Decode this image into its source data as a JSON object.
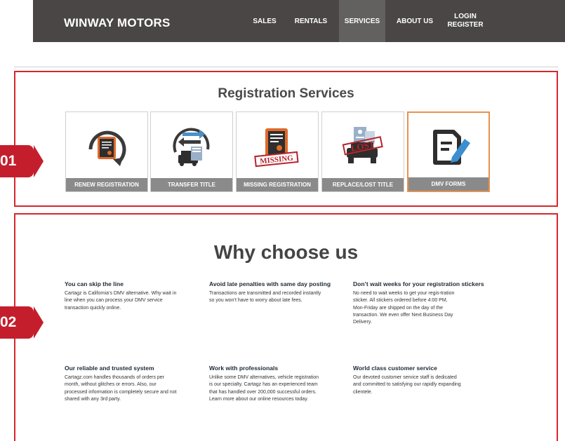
{
  "nav": {
    "brand": "WINWAY MOTORS",
    "items": [
      "SALES",
      "RENTALS",
      "SERVICES",
      "ABOUT US"
    ],
    "active": "SERVICES",
    "login": "LOGIN",
    "register": "REGISTER"
  },
  "markers": [
    "01",
    "02"
  ],
  "registration": {
    "title": "Registration Services",
    "cards": [
      {
        "label": "RENEW REGISTRATION",
        "icon": "renew-certificate-icon"
      },
      {
        "label": "TRANSFER TITLE",
        "icon": "transfer-car-icon"
      },
      {
        "label": "MISSING REGISTRATION",
        "icon": "missing-certificate-icon"
      },
      {
        "label": "REPLACE/LOST TITLE",
        "icon": "lost-title-car-icon"
      },
      {
        "label": "DMV FORMS",
        "icon": "form-edit-icon"
      }
    ]
  },
  "why": {
    "title": "Why choose us",
    "features": [
      {
        "title": "You can skip the line",
        "text": "Cartagz is California’s DMV alternative. Why wait in line when you can process your DMV service transaction quickly online."
      },
      {
        "title": "Avoid late penalties with same day posting",
        "text": "Transactions are transmitted and recorded instantly so you won’t have to worry about late fees."
      },
      {
        "title": "Don’t wait weeks for your registration stickers",
        "text": "No need to wait weeks to get your regis-tration sticker. All stickers ordered before 4:00 PM, Mon-Friday are shipped on the day of the transaction. We even offer Next Business Day Delivery."
      },
      {
        "title": "Our reliable and trusted system",
        "text": "Cartagz.com handles thousands of orders per month, without glitches or errors. Also, our processed information is completely secure and not shared with any 3rd party."
      },
      {
        "title": "Work with professionals",
        "text": "Unlike some DMV alternatives, vehicle registration is our specialty. Cartagz has an experienced team that has handled over 200,000 successful orders. Learn more about our online resources today."
      },
      {
        "title": "World class customer service",
        "text": "Our devoted customer service staff is dedicated and committed to satisfying our rapidly expanding clientele."
      }
    ]
  },
  "colors": {
    "nav_bg": "#4a4646",
    "accent_red": "#d7262d",
    "highlight_orange": "#e8924e",
    "icon_dark": "#3a3a3a",
    "icon_blue": "#4a90c8"
  }
}
